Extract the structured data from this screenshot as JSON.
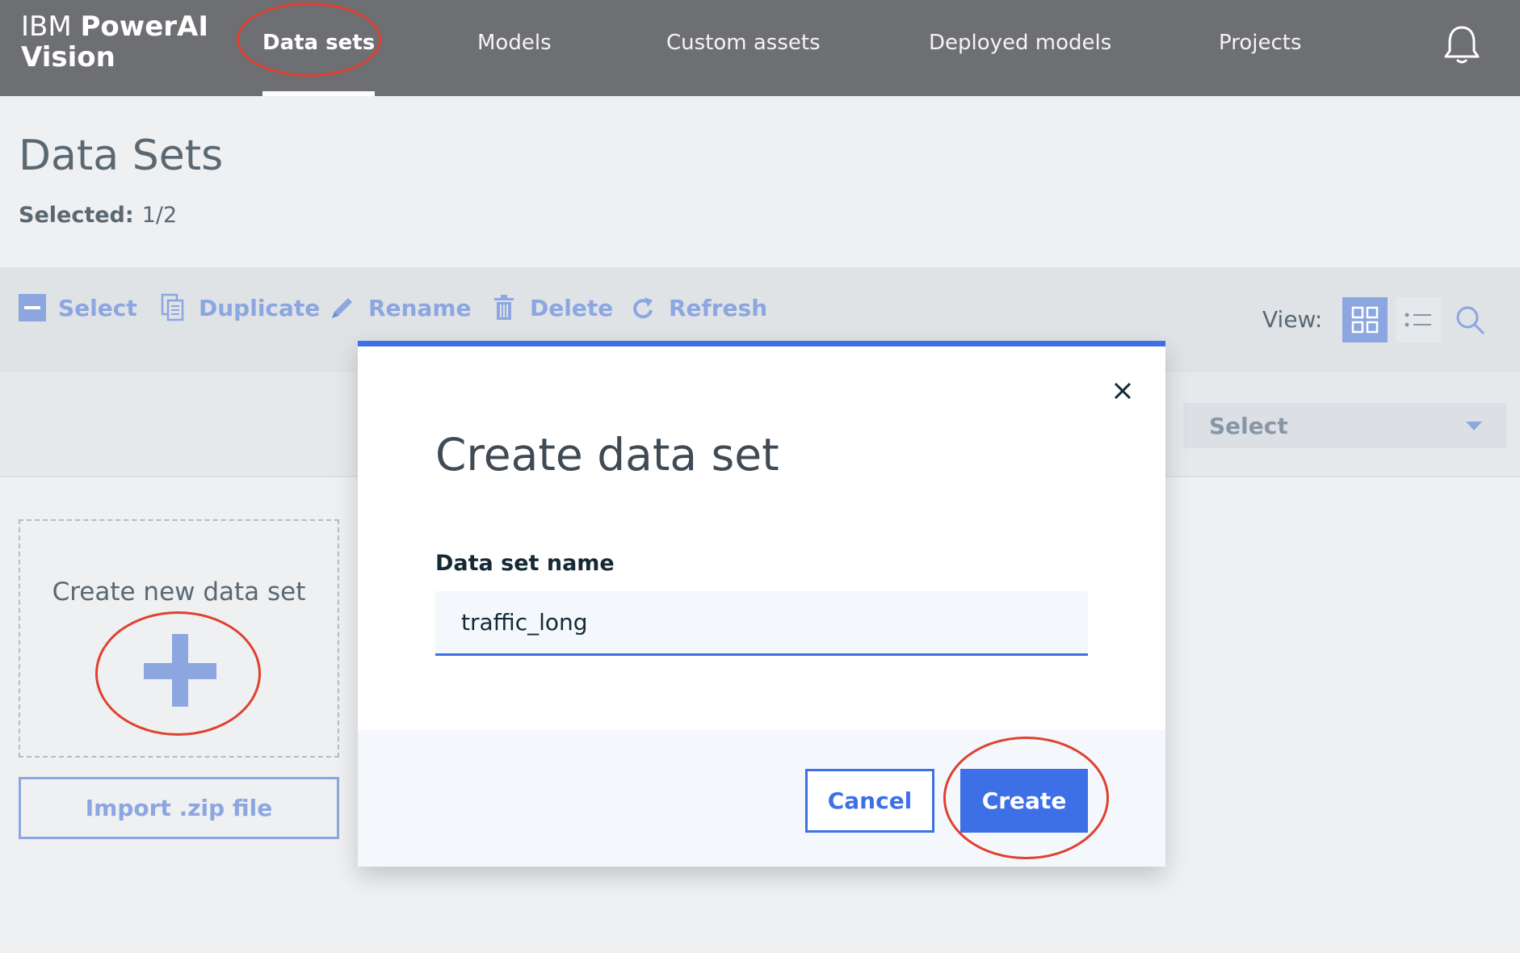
{
  "app": {
    "brand_prefix": "IBM",
    "brand_name": "PowerAI",
    "brand_line2": "Vision"
  },
  "nav": {
    "items": [
      {
        "label": "Data sets",
        "active": true
      },
      {
        "label": "Models"
      },
      {
        "label": "Custom assets"
      },
      {
        "label": "Deployed models"
      },
      {
        "label": "Projects"
      }
    ],
    "bell_icon": "bell-icon"
  },
  "page": {
    "title": "Data Sets",
    "selected_label": "Selected:",
    "selected_value": "1/2"
  },
  "toolbar": {
    "select": "Select",
    "duplicate": "Duplicate",
    "rename": "Rename",
    "delete": "Delete",
    "refresh": "Refresh",
    "view_label": "View:",
    "view_modes": [
      "grid-view-icon",
      "list-view-icon"
    ],
    "active_view": "grid"
  },
  "filter": {
    "select_label": "Select"
  },
  "content": {
    "create_card_label": "Create new data set",
    "import_label": "Import .zip file"
  },
  "modal": {
    "title": "Create data set",
    "field_label": "Data set name",
    "field_value": "traffic_long",
    "cancel": "Cancel",
    "create": "Create"
  },
  "colors": {
    "topbar": "#6e6f72",
    "accent": "#3d70e6",
    "muted_accent": "#8ca6e0",
    "annotation": "#e0402f"
  }
}
